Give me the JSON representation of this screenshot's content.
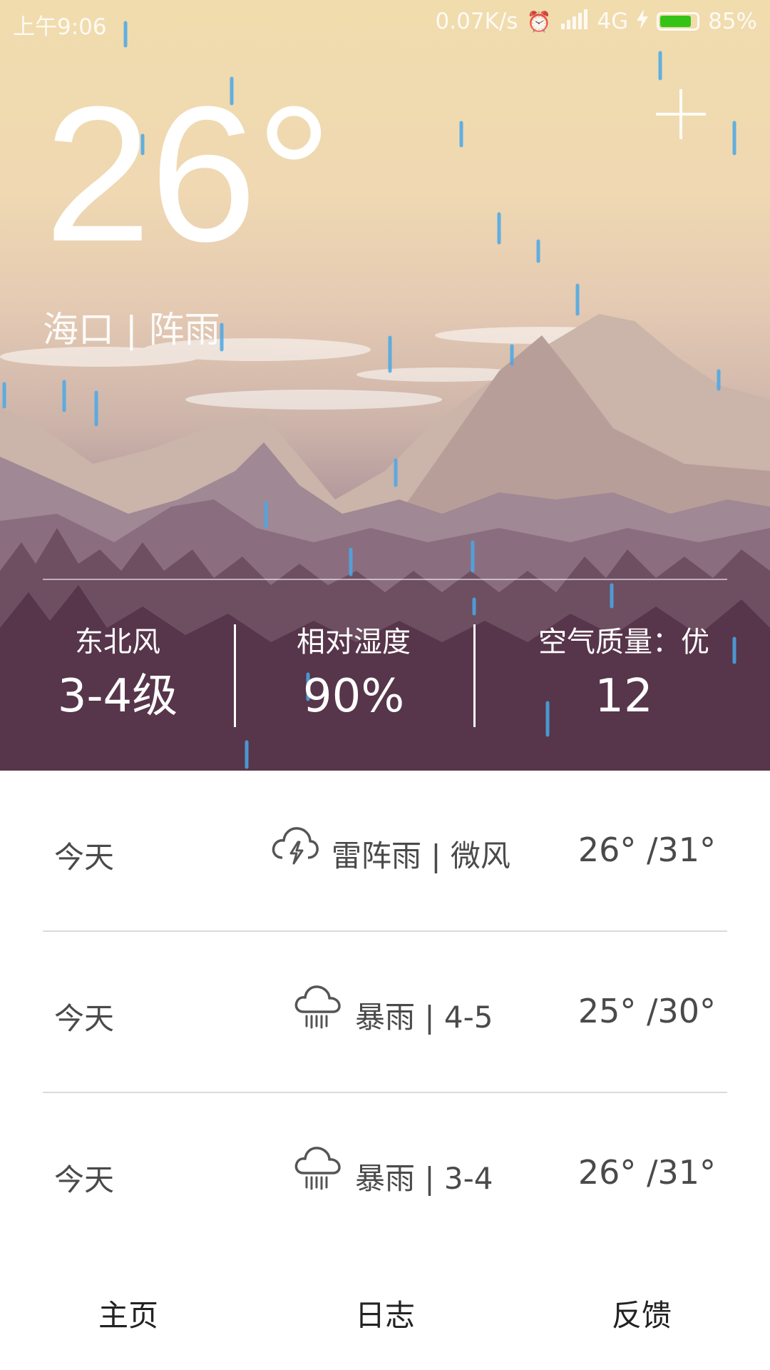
{
  "status_bar": {
    "time": "上午9:06",
    "net_speed": "0.07K/s",
    "network": "4G",
    "battery": "85%",
    "battery_level": 0.85,
    "alarm_icon": "alarm-clock-icon",
    "signal_icon": "signal-bars-icon",
    "charging_icon": "lightning-icon",
    "battery_color": "#35c416"
  },
  "current": {
    "temperature": "26°",
    "location": "海口 | 阵雨",
    "add_icon": "plus-icon"
  },
  "stats": [
    {
      "label": "东北风",
      "value": "3-4级"
    },
    {
      "label": "相对湿度",
      "value": "90%"
    },
    {
      "label": "空气质量：优",
      "value": "12"
    }
  ],
  "forecast": [
    {
      "day": "今天",
      "icon": "thunderstorm-icon",
      "desc": "雷阵雨 | 微风",
      "temp": "26° /31°"
    },
    {
      "day": "今天",
      "icon": "heavy-rain-icon",
      "desc": "暴雨 | 4-5",
      "temp": "25° /30°"
    },
    {
      "day": "今天",
      "icon": "heavy-rain-icon",
      "desc": "暴雨 | 3-4",
      "temp": "26° /31°"
    }
  ],
  "tabs": [
    {
      "label": "主页"
    },
    {
      "label": "日志"
    },
    {
      "label": "反馈"
    }
  ]
}
